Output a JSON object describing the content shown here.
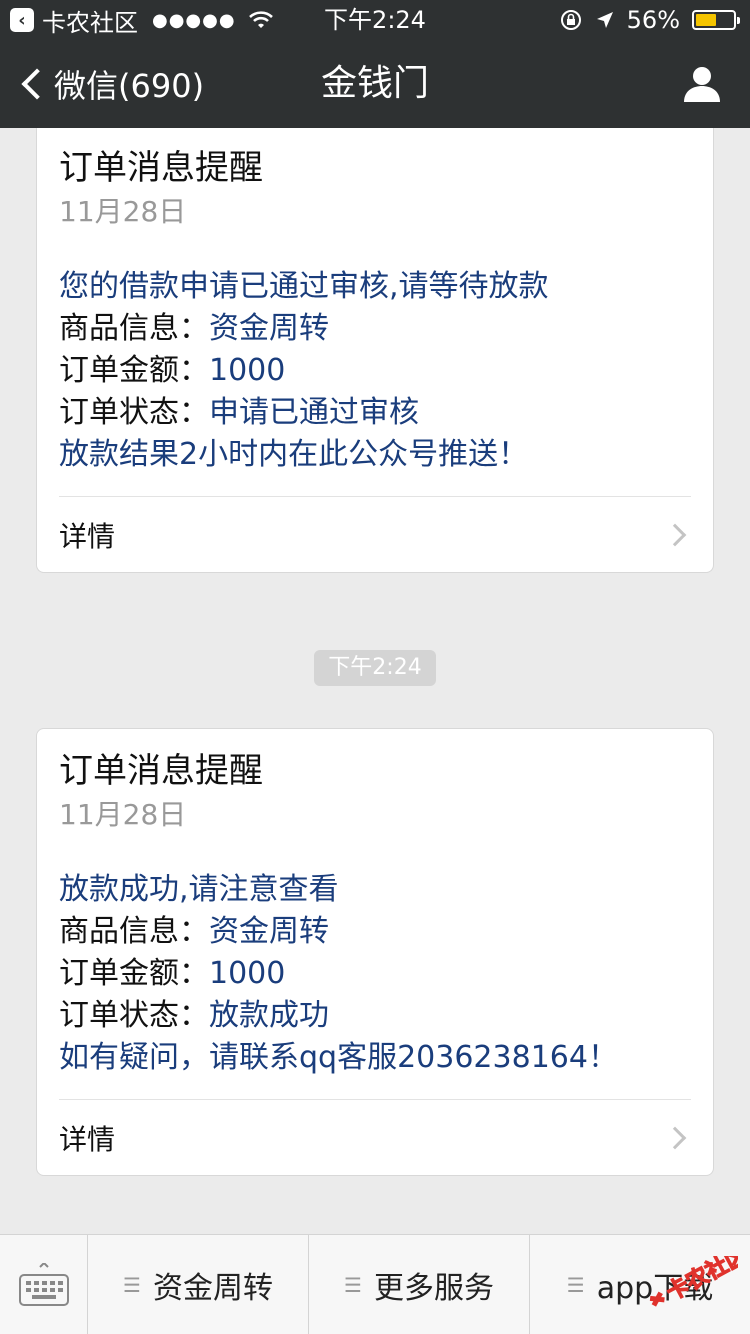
{
  "status_bar": {
    "back_app_label": "卡农社区",
    "signal": "●●●●●",
    "time": "下午2:24",
    "battery_percent": "56%",
    "battery_level": 0.56,
    "battery_color": "#f5c500"
  },
  "nav": {
    "back_label": "微信(690)",
    "title": "金钱门"
  },
  "messages": [
    {
      "title": "订单消息提醒",
      "date": "11月28日",
      "headline": "您的借款申请已通过审核,请等待放款",
      "product_label": "商品信息：",
      "product_value": "资金周转",
      "amount_label": "订单金额：",
      "amount_value": "1000",
      "status_label": "订单状态：",
      "status_value": "申请已通过审核",
      "note": "放款结果2小时内在此公众号推送！",
      "detail_label": "详情"
    },
    {
      "title": "订单消息提醒",
      "date": "11月28日",
      "headline": "放款成功,请注意查看",
      "product_label": "商品信息：",
      "product_value": "资金周转",
      "amount_label": "订单金额：",
      "amount_value": "1000",
      "status_label": "订单状态：",
      "status_value": "放款成功",
      "note": "如有疑问，请联系qq客服2036238164！",
      "detail_label": "详情"
    }
  ],
  "timestamp_pill": "下午2:24",
  "bottom_menu": [
    {
      "label": "资金周转"
    },
    {
      "label": "更多服务"
    },
    {
      "label": "app下载"
    }
  ],
  "watermark": "卡农社区",
  "colors": {
    "header_bg": "#2e3132",
    "link_blue": "#1a3d7c",
    "page_bg": "#ebebeb"
  }
}
